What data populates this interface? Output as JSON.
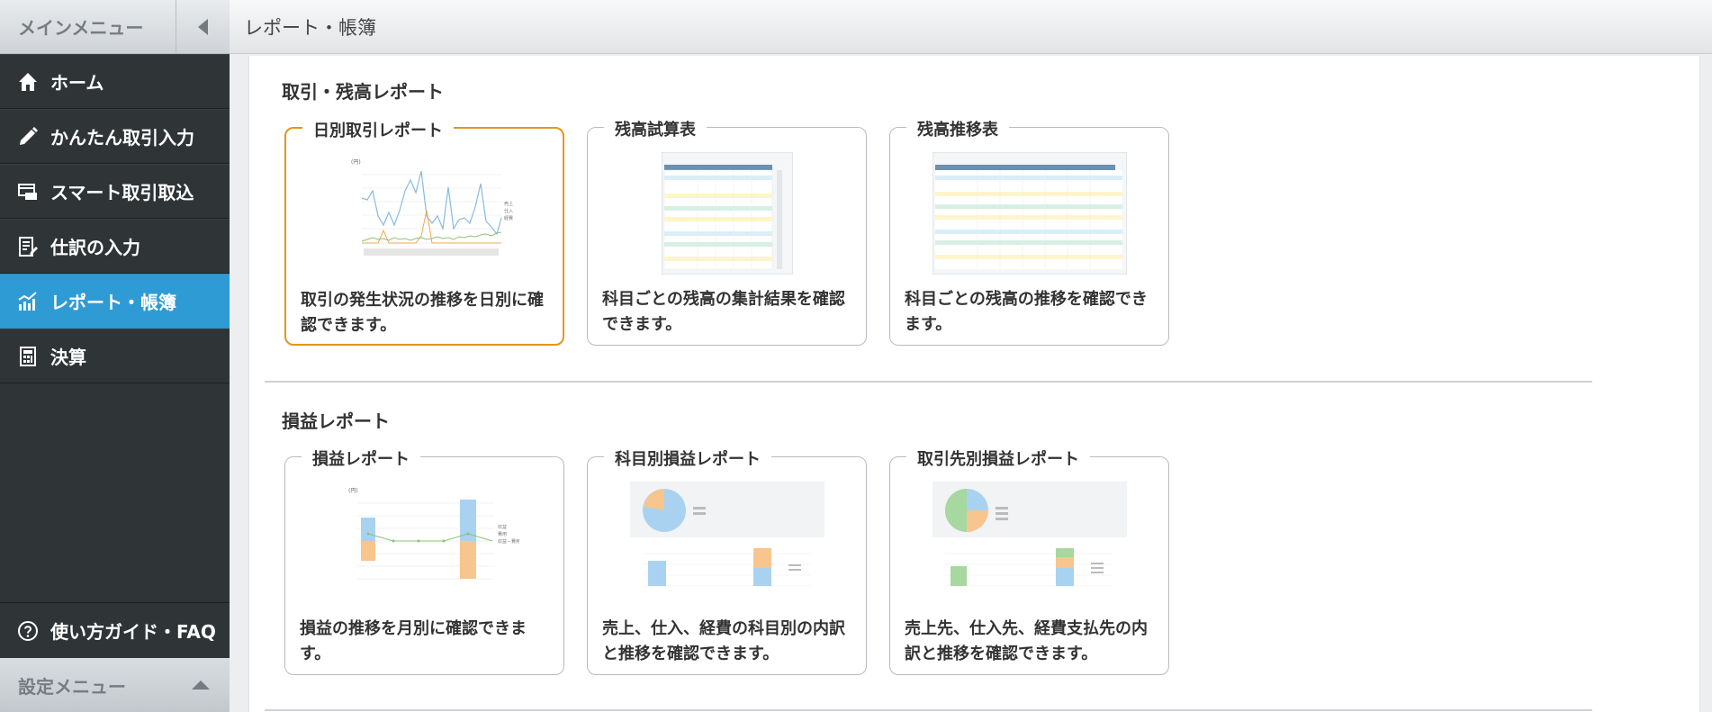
{
  "sidebar": {
    "header_title": "メインメニュー",
    "items": [
      {
        "label": "ホーム",
        "icon": "home-icon"
      },
      {
        "label": "かんたん取引入力",
        "icon": "pencil-icon"
      },
      {
        "label": "スマート取引取込",
        "icon": "import-icon"
      },
      {
        "label": "仕訳の入力",
        "icon": "journal-icon"
      },
      {
        "label": "レポート・帳簿",
        "icon": "report-chart-icon"
      },
      {
        "label": "決算",
        "icon": "calculator-icon"
      }
    ],
    "help_label": "使い方ガイド・FAQ",
    "settings_label": "設定メニュー",
    "active_color": "#2f9bd5"
  },
  "header": {
    "title": "レポート・帳簿"
  },
  "sections": [
    {
      "title": "取引・残高レポート",
      "cards": [
        {
          "title": "日別取引レポート",
          "description": "取引の発生状況の推移を日別に確認できます。",
          "highlight_color": "#e3961e"
        },
        {
          "title": "残高試算表",
          "description": "科目ごとの残高の集計結果を確認できます。"
        },
        {
          "title": "残高推移表",
          "description": "科目ごとの残高の推移を確認できます。"
        }
      ]
    },
    {
      "title": "損益レポート",
      "cards": [
        {
          "title": "損益レポート",
          "description": "損益の推移を月別に確認できます。"
        },
        {
          "title": "科目別損益レポート",
          "description": "売上、仕入、経費の科目別の内訳と推移を確認できます。"
        },
        {
          "title": "取引先別損益レポート",
          "description": "売上先、仕入先、経費支払先の内訳と推移を確認できます。"
        }
      ]
    }
  ]
}
